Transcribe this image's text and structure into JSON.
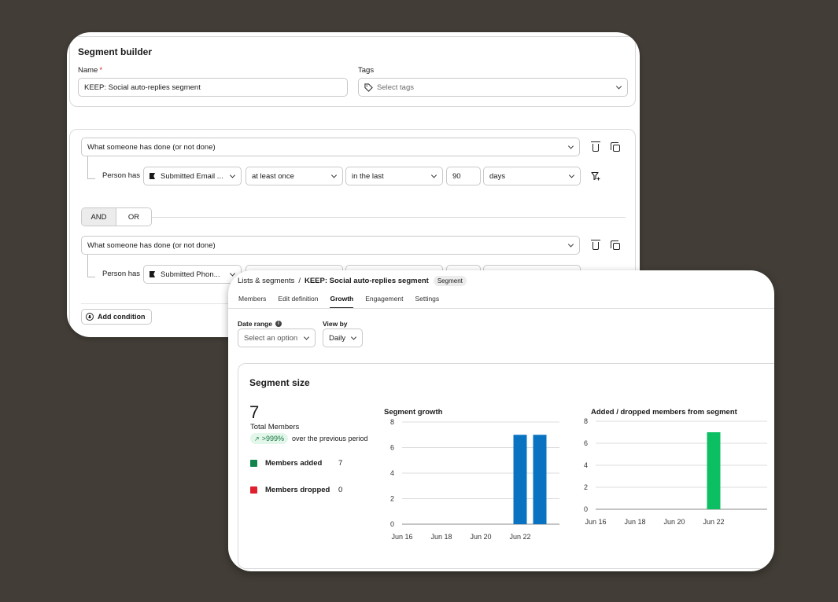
{
  "builder": {
    "title": "Segment builder",
    "name_label": "Name",
    "name_value": "KEEP: Social auto-replies segment",
    "tags_label": "Tags",
    "tags_placeholder": "Select tags",
    "conditions": [
      {
        "type": "What someone has done (or not done)",
        "person_has": "Person has",
        "metric": "Submitted Email ...",
        "frequency": "at least once",
        "timeframe": "in the last",
        "amount": "90",
        "unit": "days"
      },
      {
        "type": "What someone has done (or not done)",
        "person_has": "Person has",
        "metric": "Submitted Phon..."
      }
    ],
    "and_label": "AND",
    "or_label": "OR",
    "add_condition": "Add condition"
  },
  "growth": {
    "breadcrumb": {
      "parent": "Lists & segments",
      "separator": "/",
      "current": "KEEP: Social auto-replies segment",
      "badge": "Segment"
    },
    "tabs": [
      "Members",
      "Edit definition",
      "Growth",
      "Engagement",
      "Settings"
    ],
    "active_tab": "Growth",
    "date_range_label": "Date range",
    "date_range_placeholder": "Select an option",
    "view_by_label": "View by",
    "view_by_value": "Daily",
    "size_title": "Segment size",
    "total_members_value": "7",
    "total_members_label": "Total Members",
    "trend_value": ">999%",
    "trend_text": "over the previous period",
    "legend": [
      {
        "label": "Members added",
        "value": "7",
        "color": "#11854a"
      },
      {
        "label": "Members dropped",
        "value": "0",
        "color": "#e0202f"
      }
    ]
  },
  "chart_data": [
    {
      "type": "bar",
      "title": "Segment growth",
      "x_ticks": [
        "Jun 16",
        "Jun 18",
        "Jun 20",
        "Jun 22"
      ],
      "bars": [
        {
          "x": "Jun 22",
          "value": 7
        },
        {
          "x": "Jun 23",
          "value": 7
        }
      ],
      "ylim": [
        0,
        8
      ],
      "yticks": [
        0,
        2,
        4,
        6,
        8
      ],
      "color": "#0a73c1",
      "grid": true
    },
    {
      "type": "bar",
      "title": "Added / dropped members from segment",
      "x_ticks": [
        "Jun 16",
        "Jun 18",
        "Jun 20",
        "Jun 22"
      ],
      "bars": [
        {
          "x": "Jun 22",
          "value": 7
        }
      ],
      "ylim": [
        0,
        8
      ],
      "yticks": [
        0,
        2,
        4,
        6,
        8
      ],
      "color": "#0dbf63",
      "grid": true
    }
  ]
}
